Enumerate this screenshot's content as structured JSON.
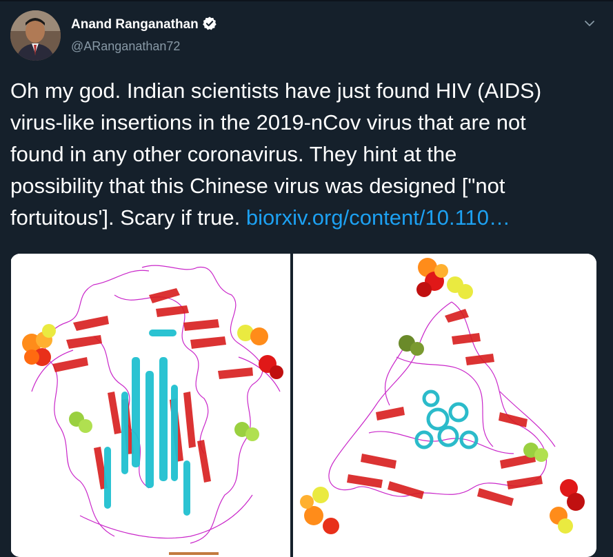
{
  "author": {
    "name": "Anand Ranganathan",
    "handle": "@ARanganathan72",
    "verified": true
  },
  "tweet": {
    "lines": [
      "Oh my god. Indian scientists have just found HIV (AIDS)",
      "virus-like insertions in the 2019-nCov virus that are not",
      "found in any other coronavirus. They hint at the",
      "possibility that this Chinese virus was designed [\"not"
    ],
    "last_line_text": "fortuitous']. Scary if true. ",
    "link_text": "biorxiv.org/content/10.110…"
  },
  "media": {
    "images": [
      {
        "icon": "protein-structure-side-view-image"
      },
      {
        "icon": "protein-structure-top-view-image"
      }
    ]
  },
  "colors": {
    "background": "#15202b",
    "text": "#ffffff",
    "secondary_text": "#8899a6",
    "link": "#1da1f2",
    "verified_badge": "#ffffff"
  }
}
